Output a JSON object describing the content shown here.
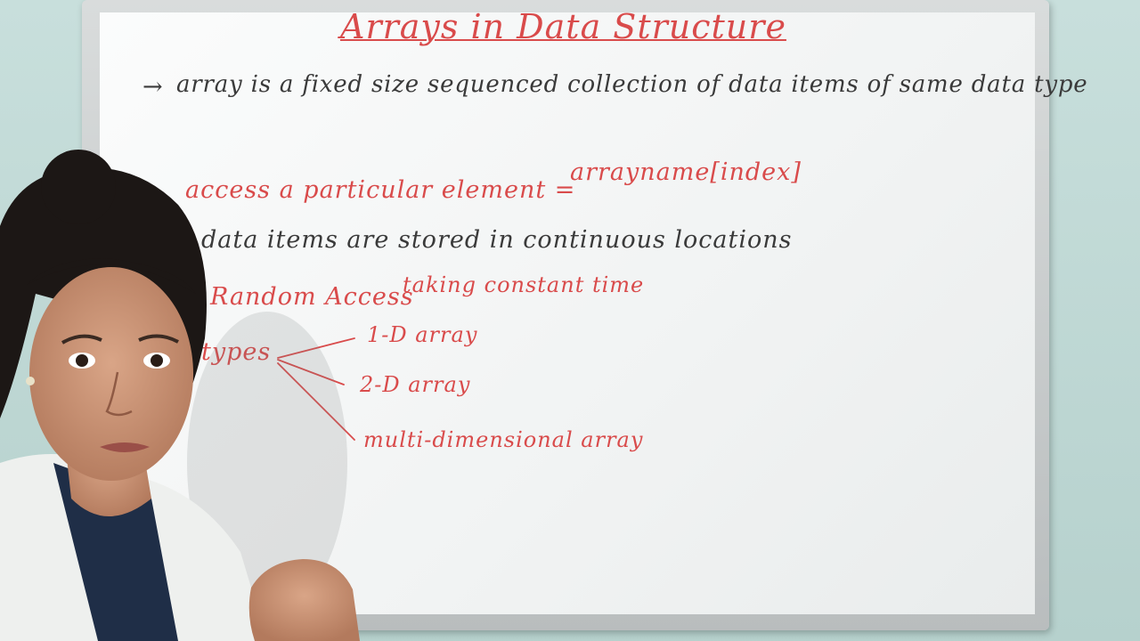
{
  "board": {
    "title": "Arrays in Data Structure",
    "definition_prefix": "→",
    "definition": "array is a fixed size sequenced collection of data items of same data type",
    "access_prefix": "→",
    "access_text": "access a particular element =",
    "access_syntax": "arrayname[index]",
    "storage_text": "data items are stored in continuous locations",
    "random_access": "Random Access",
    "constant_time": "taking constant time",
    "types_label": "types",
    "types": [
      "1-D array",
      "2-D array",
      "multi-dimensional array"
    ]
  },
  "colors": {
    "marker_red": "#d94b4b",
    "marker_black": "#3a3a3a",
    "board_white": "#f5f7f7",
    "wall": "#bcd6d2"
  }
}
